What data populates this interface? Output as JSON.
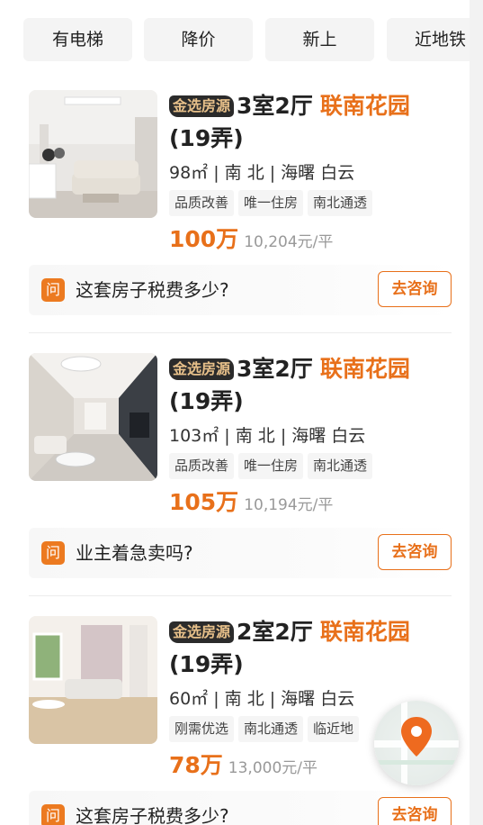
{
  "filters": [
    "有电梯",
    "降价",
    "新上",
    "近地铁"
  ],
  "listings": [
    {
      "badge": "金选房源",
      "layout": "3室2厅",
      "community": "联南花园",
      "lane": "(19弄)",
      "spec": "98㎡ | 南 北 | 海曙 白云",
      "tags": [
        "品质改善",
        "唯一住房",
        "南北通透"
      ],
      "price": "100万",
      "unit_price": "10,204元/平",
      "question": "这套房子税费多少?",
      "consult_label": "去咨询",
      "qa_icon": "问"
    },
    {
      "badge": "金选房源",
      "layout": "3室2厅",
      "community": "联南花园",
      "lane": "(19弄)",
      "spec": "103㎡ | 南 北 | 海曙 白云",
      "tags": [
        "品质改善",
        "唯一住房",
        "南北通透"
      ],
      "price": "105万",
      "unit_price": "10,194元/平",
      "question": "业主着急卖吗?",
      "consult_label": "去咨询",
      "qa_icon": "问"
    },
    {
      "badge": "金选房源",
      "layout": "2室2厅",
      "community": "联南花园",
      "lane": "(19弄)",
      "spec": "60㎡ | 南 北 | 海曙 白云",
      "tags": [
        "刚需优选",
        "南北通透",
        "临近地"
      ],
      "price": "78万",
      "unit_price": "13,000元/平",
      "question": "这套房子税费多少?",
      "consult_label": "去咨询",
      "qa_icon": "问"
    }
  ],
  "colors": {
    "accent": "#e8701a",
    "badge_bg": "#2b2b2b",
    "badge_text": "#e7c08a"
  },
  "icons": {
    "map_button": "map-pin-icon",
    "question": "question-icon"
  }
}
